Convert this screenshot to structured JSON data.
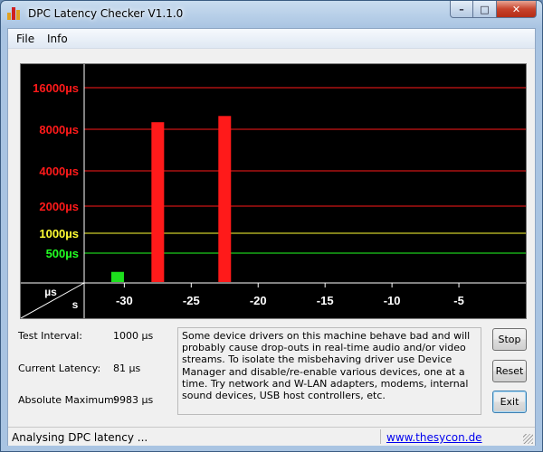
{
  "window": {
    "title": "DPC Latency Checker V1.1.0",
    "app_icon": "bar-chart-icon",
    "controls": {
      "minimize_glyph": "–",
      "maximize_glyph": "□",
      "close_glyph": "✕"
    }
  },
  "menu": {
    "items": [
      {
        "label": "File"
      },
      {
        "label": "Info"
      }
    ]
  },
  "chart_data": {
    "type": "bar",
    "y_tick_labels": [
      {
        "label": "16000µs",
        "color": "#ff1a1a"
      },
      {
        "label": "8000µs",
        "color": "#ff1a1a"
      },
      {
        "label": "4000µs",
        "color": "#ff1a1a"
      },
      {
        "label": "2000µs",
        "color": "#ff1a1a"
      },
      {
        "label": "1000µs",
        "color": "#ffff33"
      },
      {
        "label": "500µs",
        "color": "#22ff22"
      }
    ],
    "y_scale": "log2",
    "y_values_us": [
      16000,
      8000,
      4000,
      2000,
      1000,
      500
    ],
    "gridline_colors": {
      "red": "#ff1a1a",
      "yellow": "#ffff33",
      "green": "#22ff22"
    },
    "corner_top_label": "µs",
    "corner_bottom_label": "s",
    "x_tick_labels": [
      "-30",
      "-25",
      "-20",
      "-15",
      "-10",
      "-5"
    ],
    "xlim_s": [
      -33,
      0
    ],
    "bar_times_s": [
      -32.5,
      -31.5,
      -30.5,
      -29.5,
      -28.5,
      -27.5,
      -26.5,
      -25.5,
      -24.5,
      -23.5,
      -22.5,
      -21.5,
      -20.5,
      -19.5,
      -18.5,
      -17.5,
      -16.5,
      -15.5,
      -14.5,
      -13.5,
      -12.5,
      -11.5,
      -10.5,
      -9.5,
      -8.5,
      -7.5,
      -6.5,
      -5.5,
      -4.5,
      -3.5,
      -2.5,
      -1.5,
      -0.5
    ],
    "values_us": [
      150,
      110,
      260,
      160,
      150,
      9000,
      110,
      110,
      100,
      110,
      9983,
      110,
      180,
      110,
      110,
      110,
      120,
      120,
      100,
      140,
      110,
      110,
      110,
      110,
      110,
      100,
      110,
      100,
      110,
      110,
      110,
      140,
      100
    ],
    "bar_colors": {
      "normal": "#1de01d",
      "high": "#ff1a1a"
    }
  },
  "stats": {
    "test_interval": {
      "label": "Test Interval:",
      "value": "1000 µs"
    },
    "current_latency": {
      "label": "Current Latency:",
      "value": "81 µs"
    },
    "absolute_maximum": {
      "label": "Absolute Maximum:",
      "value": "9983 µs"
    }
  },
  "description": "Some device drivers on this machine behave bad and will probably cause drop-outs in real-time audio and/or video streams. To isolate the misbehaving driver use Device Manager and disable/re-enable various devices, one at a time. Try network and W-LAN adapters, modems, internal sound devices, USB host controllers, etc.",
  "buttons": {
    "stop": "Stop",
    "reset": "Reset",
    "exit": "Exit"
  },
  "status": {
    "text": "Analysing DPC latency ...",
    "link": "www.thesycon.de"
  }
}
